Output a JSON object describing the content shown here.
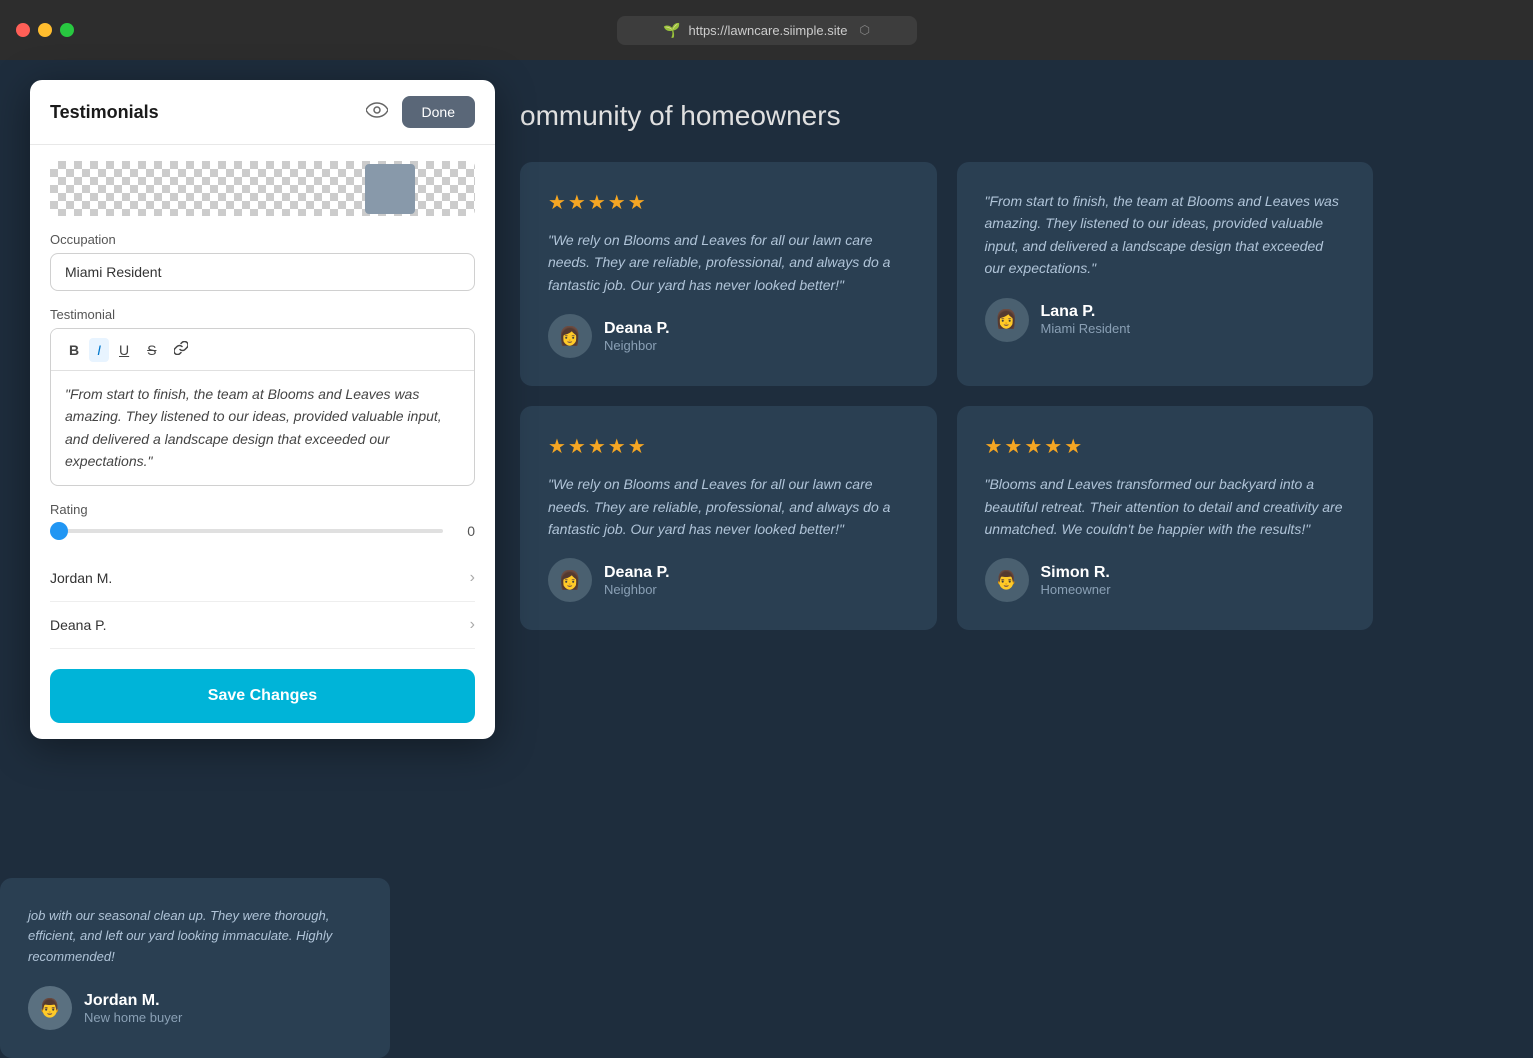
{
  "browser": {
    "url": "https://lawncare.siimple.site",
    "favicon": "🌱"
  },
  "panel": {
    "title": "Testimonials",
    "done_label": "Done",
    "section_label_occupation": "Occupation",
    "occupation_value": "Miami Resident",
    "section_label_testimonial": "Testimonial",
    "testimonial_text": "\"From start to finish, the team at Blooms and Leaves was amazing. They listened to our ideas, provided valuable input, and delivered a landscape design that exceeded our expectations.\"",
    "section_label_rating": "Rating",
    "rating_value": "0",
    "toolbar_buttons": [
      "B",
      "I",
      "U",
      "S",
      "🔗"
    ],
    "list_items": [
      "Jordan M.",
      "Deana P."
    ],
    "save_label": "Save Changes"
  },
  "website": {
    "community_heading": "ommunity of homeowners",
    "cards": [
      {
        "stars": "★★★★★",
        "quote": "\"We rely on Blooms and Leaves for all our lawn care needs. They are reliable, professional, and always do a fantastic job. Our yard has never looked better!\"",
        "author_name": "Deana P.",
        "author_title": "Neighbor"
      },
      {
        "stars": "★★★★★",
        "quote": "\"From start to finish, the team at Blooms and Leaves was amazing. They listened to our ideas, provided valuable input, and delivered a landscape design that exceeded our expectations.\"",
        "author_name": "Lana P.",
        "author_title": "Miami Resident"
      },
      {
        "stars": "★★★★★",
        "quote": "\"We rely on Blooms and Leaves for all our lawn care needs. They are reliable, professional, and always do a fantastic job. Our yard has never looked better!\"",
        "author_name": "Deana P.",
        "author_title": "Neighbor"
      },
      {
        "stars": "★★★★★",
        "quote": "\"Blooms and Leaves transformed our backyard into a beautiful retreat. Their attention to detail and creativity are unmatched. We couldn't be happier with the results!\"",
        "author_name": "Simon R.",
        "author_title": "Homeowner"
      }
    ],
    "bottom_card": {
      "quote": "job with our seasonal clean up. They were thorough, efficient, and left our yard looking immaculate. Highly recommended!",
      "author_name": "Jordan M.",
      "author_title": "New home buyer"
    }
  }
}
